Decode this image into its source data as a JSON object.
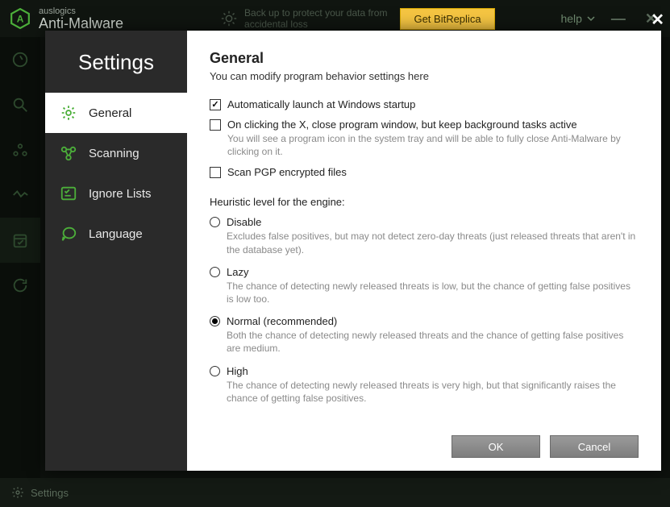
{
  "app": {
    "brand_top": "auslogics",
    "brand_bottom": "Anti-Malware",
    "promo_line1": "Back up to protect your data from",
    "promo_line2": "accidental loss",
    "promo_button": "Get BitReplica",
    "help_label": "help",
    "footer_label": "Settings"
  },
  "modal": {
    "title": "Settings",
    "nav": {
      "general": "General",
      "scanning": "Scanning",
      "ignore": "Ignore Lists",
      "language": "Language"
    },
    "page_title": "General",
    "page_sub": "You can modify program behavior settings here",
    "chk_startup": "Automatically launch at Windows startup",
    "chk_closebg": "On clicking the X, close program window, but keep background tasks active",
    "chk_closebg_desc": "You will see a program icon in the system tray and will be able to fully close Anti-Malware by clicking on it.",
    "chk_pgp": "Scan PGP encrypted files",
    "heuristic_label": "Heuristic level for the engine:",
    "radio_disable": "Disable",
    "radio_disable_desc": "Excludes false positives, but may not detect zero-day threats (just released threats that aren't in the database yet).",
    "radio_lazy": "Lazy",
    "radio_lazy_desc": "The chance of detecting newly released threats is low, but the chance of getting false positives is low too.",
    "radio_normal": "Normal (recommended)",
    "radio_normal_desc": "Both the chance of detecting newly released threats and the chance of getting false positives are medium.",
    "radio_high": "High",
    "radio_high_desc": "The chance of detecting newly released threats is very high, but that significantly raises the chance of getting false positives.",
    "btn_ok": "OK",
    "btn_cancel": "Cancel"
  }
}
